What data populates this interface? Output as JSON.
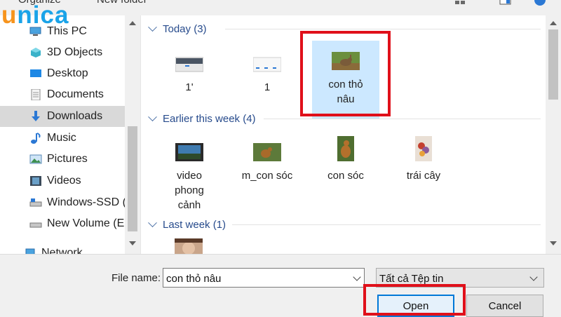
{
  "logo": {
    "first": "u",
    "rest": "nica"
  },
  "toolbar": {
    "organize": "Organize",
    "new_folder": "New folder"
  },
  "nav": {
    "items": [
      {
        "label": "This PC",
        "icon": "pc-icon"
      },
      {
        "label": "3D Objects",
        "icon": "3d-objects-icon"
      },
      {
        "label": "Desktop",
        "icon": "desktop-icon"
      },
      {
        "label": "Documents",
        "icon": "documents-icon"
      },
      {
        "label": "Downloads",
        "icon": "downloads-icon",
        "selected": true
      },
      {
        "label": "Music",
        "icon": "music-icon"
      },
      {
        "label": "Pictures",
        "icon": "pictures-icon"
      },
      {
        "label": "Videos",
        "icon": "videos-icon"
      },
      {
        "label": "Windows-SSD (C",
        "icon": "drive-icon"
      },
      {
        "label": "New Volume (E:)",
        "icon": "drive-icon"
      },
      {
        "label": "Network",
        "icon": "network-icon"
      }
    ]
  },
  "groups": [
    {
      "header": "Today (3)",
      "files": [
        {
          "name": "1'"
        },
        {
          "name": "1"
        },
        {
          "name": "con thỏ\nnâu",
          "selected": true
        }
      ]
    },
    {
      "header": "Earlier this week (4)",
      "files": [
        {
          "name": "video\nphong\ncảnh"
        },
        {
          "name": "m_con sóc"
        },
        {
          "name": "con sóc"
        },
        {
          "name": "trái cây"
        }
      ]
    },
    {
      "header": "Last week (1)",
      "files": []
    }
  ],
  "footer": {
    "file_name_label": "File name:",
    "file_name_value": "con thỏ nâu",
    "file_type_value": "Tất cả Tệp tin",
    "open_label": "Open",
    "cancel_label": "Cancel"
  },
  "colors": {
    "accent": "#0078d7",
    "highlight_box": "#e0101a",
    "selection": "#cce8ff",
    "group_header": "#274b8c"
  }
}
